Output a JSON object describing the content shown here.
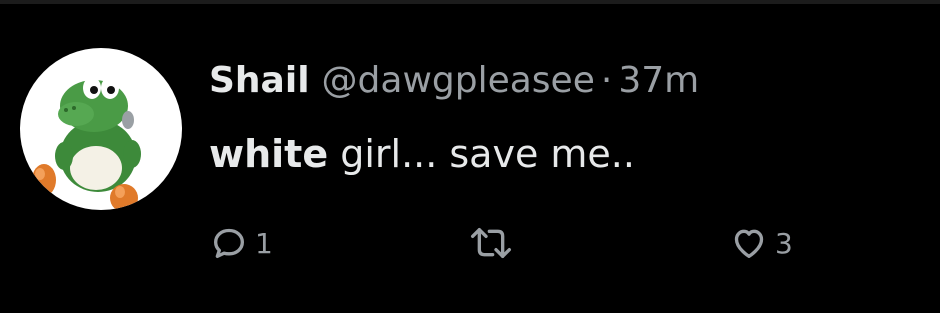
{
  "tweet": {
    "display_name": "Shail",
    "handle": "@dawgpleasee",
    "separator": "·",
    "time": "37m",
    "text_bold": "white",
    "text_rest": " girl... save me..",
    "reply_count": "1",
    "retweet_count": "",
    "like_count": "3"
  },
  "icons": {
    "reply": "reply-bubble-icon",
    "retweet": "retweet-icon",
    "like": "heart-icon"
  },
  "colors": {
    "background": "#000000",
    "text_primary": "#e7e9ea",
    "text_secondary": "#9a9fa4",
    "avatar_bg": "#ffffff"
  }
}
